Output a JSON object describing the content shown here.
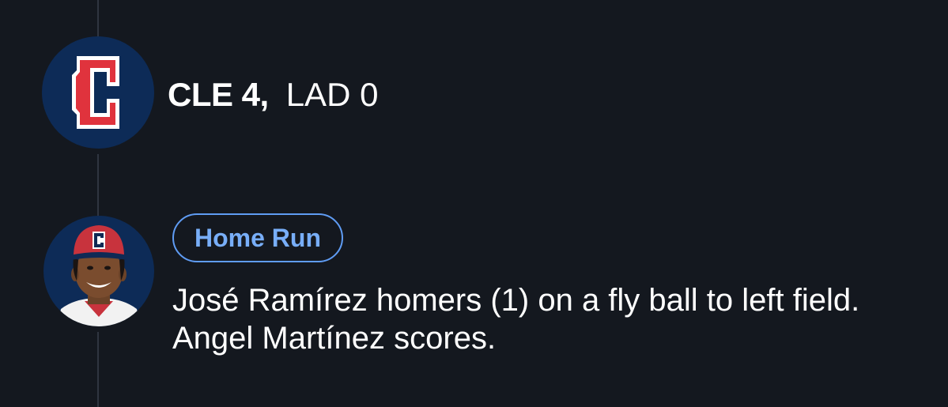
{
  "scoring_play": {
    "team": {
      "logo_letter": "C",
      "logo_icon": "cleveland-guardians-c-icon",
      "logo_bg": "#0d2b57",
      "logo_red": "#e0333d"
    },
    "score": {
      "leading": "CLE 4,",
      "trailing": "LAD 0"
    },
    "player": {
      "avatar_icon": "player-headshot-icon",
      "cap_letter": "C"
    },
    "event_type": "Home Run",
    "description": "José Ramírez homers (1) on a fly ball to left field. Angel Martínez scores."
  },
  "colors": {
    "background": "#14181f",
    "timeline": "#2f3540",
    "badge": "#5f9cf4",
    "text": "#ffffff"
  }
}
